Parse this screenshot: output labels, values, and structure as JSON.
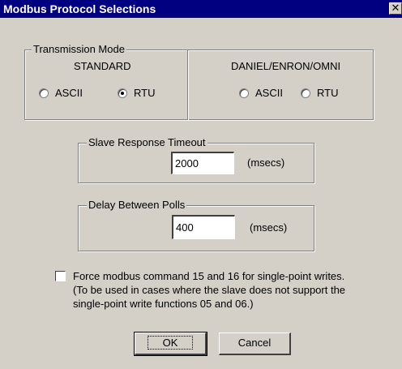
{
  "window": {
    "title": "Modbus Protocol Selections",
    "close_glyph": "✕"
  },
  "transmission_mode": {
    "legend": "Transmission Mode",
    "standard": {
      "heading": "STANDARD",
      "ascii_label": "ASCII",
      "rtu_label": "RTU",
      "selected": "RTU"
    },
    "daniel": {
      "heading": "DANIEL/ENRON/OMNI",
      "ascii_label": "ASCII",
      "rtu_label": "RTU",
      "selected": "none"
    }
  },
  "slave_timeout": {
    "legend": "Slave Response Timeout",
    "value": "2000",
    "unit": "(msecs)"
  },
  "delay_polls": {
    "legend": "Delay Between Polls",
    "value": "400",
    "unit": "(msecs)"
  },
  "force_option": {
    "checked": false,
    "line1": "Force modbus command 15 and 16 for single-point writes.",
    "line2": "(To be used in cases where the slave does not support the",
    "line3": "single-point write functions 05 and 06.)"
  },
  "buttons": {
    "ok_label": "OK",
    "cancel_label": "Cancel"
  }
}
